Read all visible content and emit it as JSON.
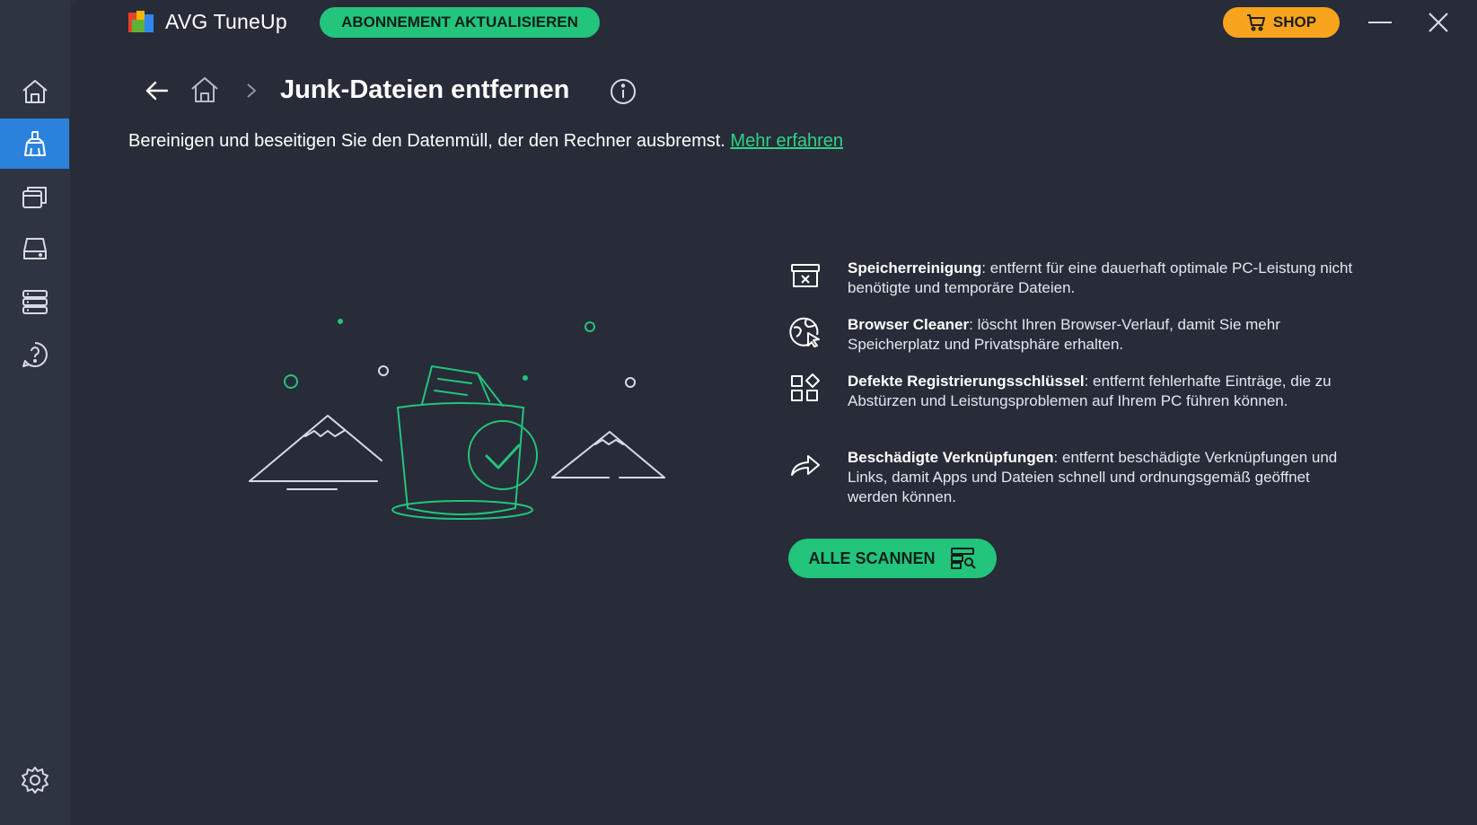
{
  "app": {
    "title": "AVG TuneUp"
  },
  "header": {
    "upgrade_label": "ABONNEMENT AKTUALISIEREN",
    "shop_label": "SHOP"
  },
  "colors": {
    "accent_green": "#23c47c",
    "shop_orange": "#f8a41e",
    "active_blue": "#2b82dc",
    "link_green": "#2fd287"
  },
  "sidebar": {
    "items": [
      {
        "icon": "home-icon",
        "active": false
      },
      {
        "icon": "broom-icon",
        "active": true
      },
      {
        "icon": "windows-stack-icon",
        "active": false
      },
      {
        "icon": "hard-drive-icon",
        "active": false
      },
      {
        "icon": "server-list-icon",
        "active": false
      },
      {
        "icon": "help-icon",
        "active": false
      }
    ],
    "settings_icon": "gear-icon"
  },
  "page": {
    "title": "Junk-Dateien entfernen",
    "subtitle": "Bereinigen und beseitigen Sie den Datenmüll, der den Rechner ausbremst.",
    "learn_more": "Mehr erfahren"
  },
  "features": [
    {
      "icon": "archive-x-icon",
      "title": "Speicherreinigung",
      "text": ": entfernt für eine dauerhaft optimale PC-Leistung nicht benötigte und temporäre Dateien."
    },
    {
      "icon": "globe-cursor-icon",
      "title": "Browser Cleaner",
      "text": ": löscht Ihren Browser-Verlauf, damit Sie mehr Speicherplatz und Privatsphäre erhalten."
    },
    {
      "icon": "grid-diamond-icon",
      "title": "Defekte Registrierungsschlüssel",
      "text": ": entfernt fehlerhafte Einträge, die zu Abstürzen und Leistungsproblemen auf Ihrem PC führen können."
    },
    {
      "icon": "share-arrow-icon",
      "title": "Beschädigte Verknüpfungen",
      "text": ": entfernt beschädigte Verknüpfungen und Links, damit Apps und Dateien schnell und ordnungsgemäß geöffnet werden können."
    }
  ],
  "scan_button": {
    "label": "ALLE SCANNEN",
    "icon": "scan-list-icon"
  }
}
